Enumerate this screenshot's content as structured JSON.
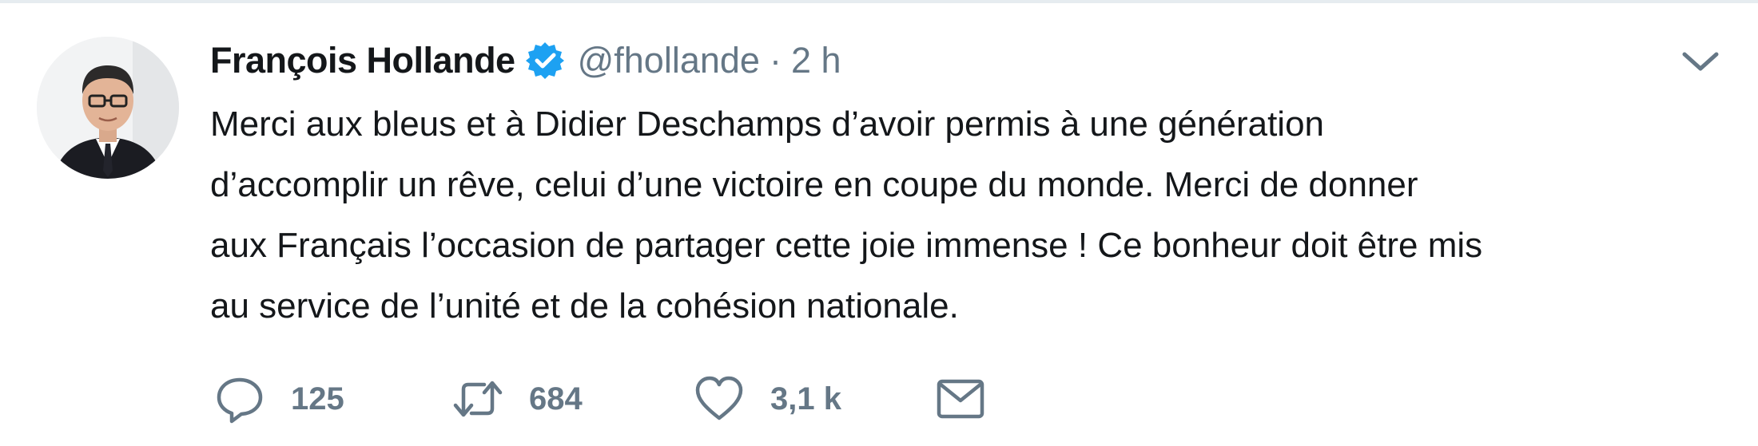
{
  "tweet": {
    "author": {
      "name": "François Hollande",
      "handle": "@fhollande",
      "verified": true,
      "avatar_icon": "avatar-photo"
    },
    "separator": "·",
    "time": "2 h",
    "text_lines": [
      "Merci aux bleus et à Didier Deschamps d’avoir permis à une génération",
      "d’accomplir un rêve, celui d’une victoire en coupe du monde. Merci de donner",
      "aux Français l’occasion de partager cette joie immense ! Ce bonheur doit être mis",
      "au service de l’unité et de la cohésion nationale."
    ],
    "actions": {
      "reply": {
        "icon": "reply-icon",
        "count": "125"
      },
      "retweet": {
        "icon": "retweet-icon",
        "count": "684"
      },
      "like": {
        "icon": "heart-icon",
        "count": "3,1 k"
      },
      "message": {
        "icon": "mail-icon"
      }
    },
    "menu_icon": "chevron-down-icon"
  },
  "colors": {
    "text": "#14171a",
    "secondary": "#657786",
    "verified": "#1da1f2",
    "border": "#e6ecf0"
  }
}
